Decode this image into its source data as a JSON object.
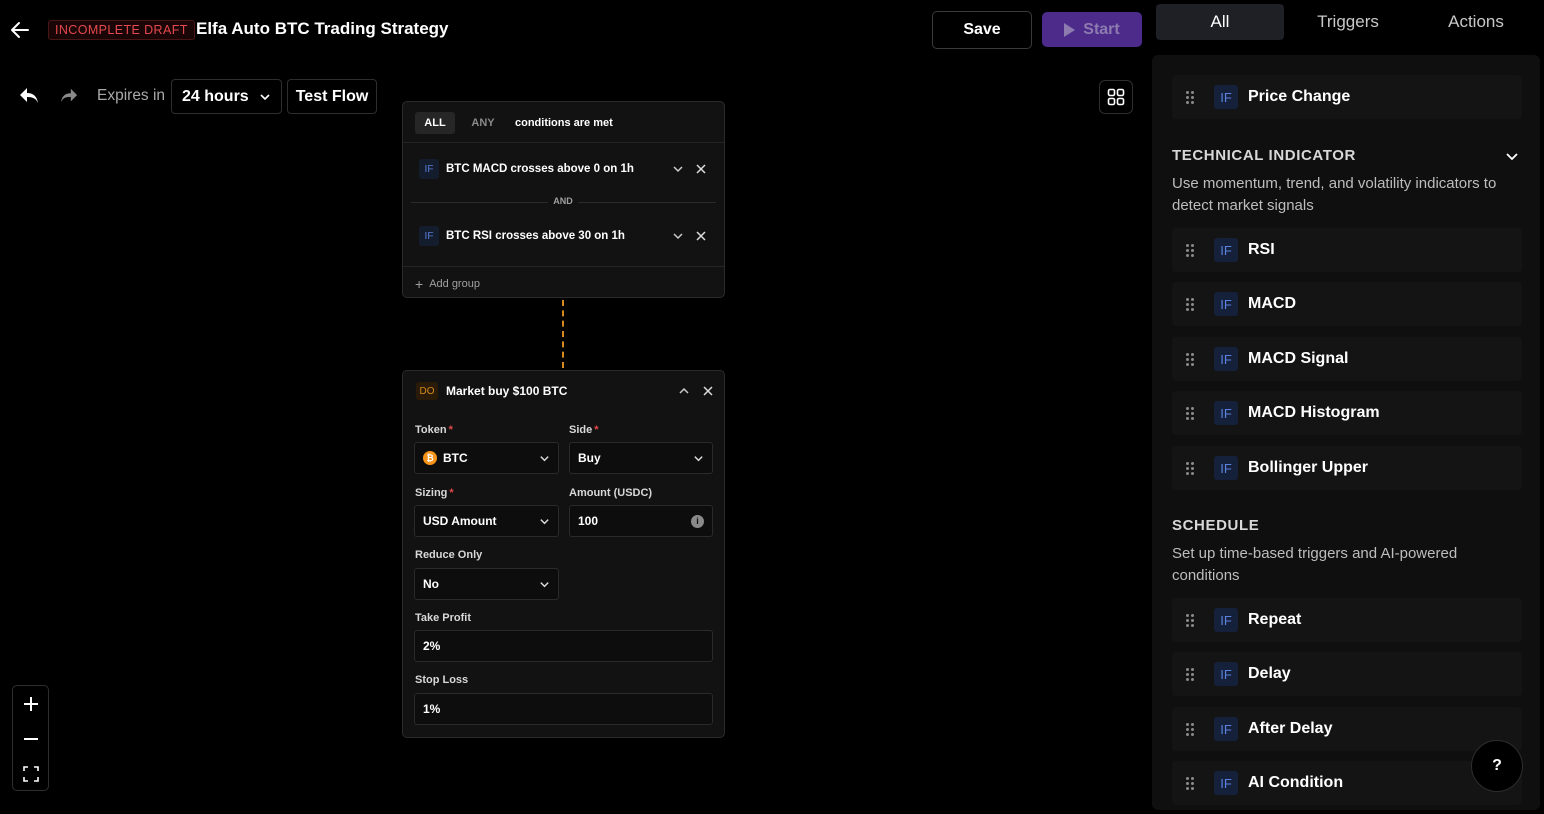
{
  "header": {
    "draft_badge": "INCOMPLETE DRAFT",
    "title": "Elfa Auto BTC Trading Strategy",
    "save_label": "Save",
    "start_label": "Start"
  },
  "toolbar": {
    "expires_label": "Expires in",
    "expires_value": "24 hours",
    "test_flow_label": "Test Flow"
  },
  "condition_card": {
    "mode_all": "ALL",
    "mode_any": "ANY",
    "mode_desc": "conditions are met",
    "if_tag": "IF",
    "conditions": [
      {
        "text": "BTC MACD crosses above 0 on 1h"
      },
      {
        "text": "BTC RSI crosses above 30 on 1h"
      }
    ],
    "joiner": "AND",
    "add_group": "Add group"
  },
  "action_card": {
    "do_tag": "DO",
    "title": "Market buy $100 BTC",
    "fields": {
      "token": {
        "label": "Token",
        "value": "BTC"
      },
      "side": {
        "label": "Side",
        "value": "Buy"
      },
      "sizing": {
        "label": "Sizing",
        "value": "USD Amount"
      },
      "amount": {
        "label": "Amount (USDC)",
        "value": "100"
      },
      "reduce_only": {
        "label": "Reduce Only",
        "value": "No"
      },
      "take_profit": {
        "label": "Take Profit",
        "value": "2%"
      },
      "stop_loss": {
        "label": "Stop Loss",
        "value": "1%"
      }
    }
  },
  "right_panel": {
    "tabs": [
      "All",
      "Triggers",
      "Actions"
    ],
    "active_tab": "All",
    "if_tag": "IF",
    "top_item": "Price Change",
    "technical_indicator": {
      "heading": "TECHNICAL INDICATOR",
      "description": "Use momentum, trend, and volatility indicators to detect market signals",
      "items": [
        "RSI",
        "MACD",
        "MACD Signal",
        "MACD Histogram",
        "Bollinger Upper"
      ]
    },
    "schedule": {
      "heading": "SCHEDULE",
      "description": "Set up time-based triggers and AI-powered conditions",
      "items": [
        "Repeat",
        "Delay",
        "After Delay",
        "AI Condition"
      ]
    }
  },
  "help_label": "?",
  "colors": {
    "accent_purple": "#4c2b8a",
    "draft_red": "#e5484d",
    "if_blue": "#5b82e0",
    "do_orange": "#d68a1e"
  }
}
